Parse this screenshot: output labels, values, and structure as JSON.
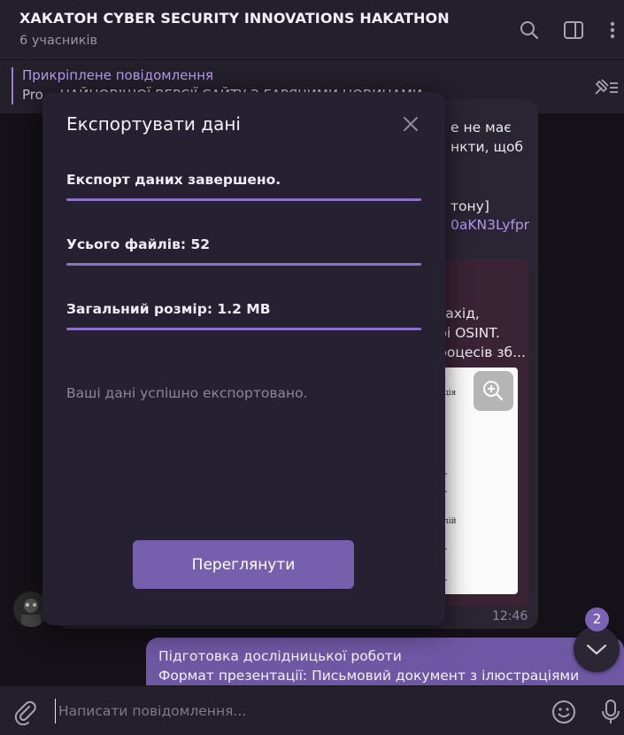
{
  "header": {
    "title": "ХАКАТОН CYBER SECURITY INNOVATIONS HAKATHON",
    "subtitle": "6 учасників"
  },
  "pinned": {
    "title": "Прикріплене повідомлення",
    "text": "Pro...  НАЙНОВІШОЇ ВЕРСІЇ САЙТУ З ГАРЯЧИМИ НОВИНАМИ"
  },
  "chat": {
    "incoming": {
      "lines": [
        "е не має",
        "нкти, щоб",
        "тону]",
        "захід,",
        "рі OSINT.",
        "роцесів зб..."
      ],
      "link": "0aKN3Lyfpr",
      "time": "12:46"
    },
    "outgoing": {
      "lines": [
        "Підготовка дослідницької роботи",
        "Формат презентації: Письмовий документ з ілюстраціями"
      ]
    },
    "unread_count": "2"
  },
  "composer": {
    "placeholder": "Написати повідомлення..."
  },
  "modal": {
    "title": "Експортувати дані",
    "status": "Експорт даних завершено.",
    "files": "Усього файлів: 52",
    "size": "Загальний розмір: 1.2 MB",
    "note": "Ваші дані успішно експортовано.",
    "button": "Переглянути",
    "progress": [
      1.0,
      1.0,
      1.0
    ]
  },
  "colors": {
    "accent": "#7660ae",
    "link": "#b497ea",
    "progress": "#8c71c8"
  },
  "icons": [
    "search-icon",
    "sidebar-toggle-icon",
    "more-vertical-icon",
    "pin-list-icon",
    "zoom-icon",
    "chevron-down-icon",
    "attach-icon",
    "emoji-icon",
    "microphone-icon",
    "close-icon"
  ]
}
